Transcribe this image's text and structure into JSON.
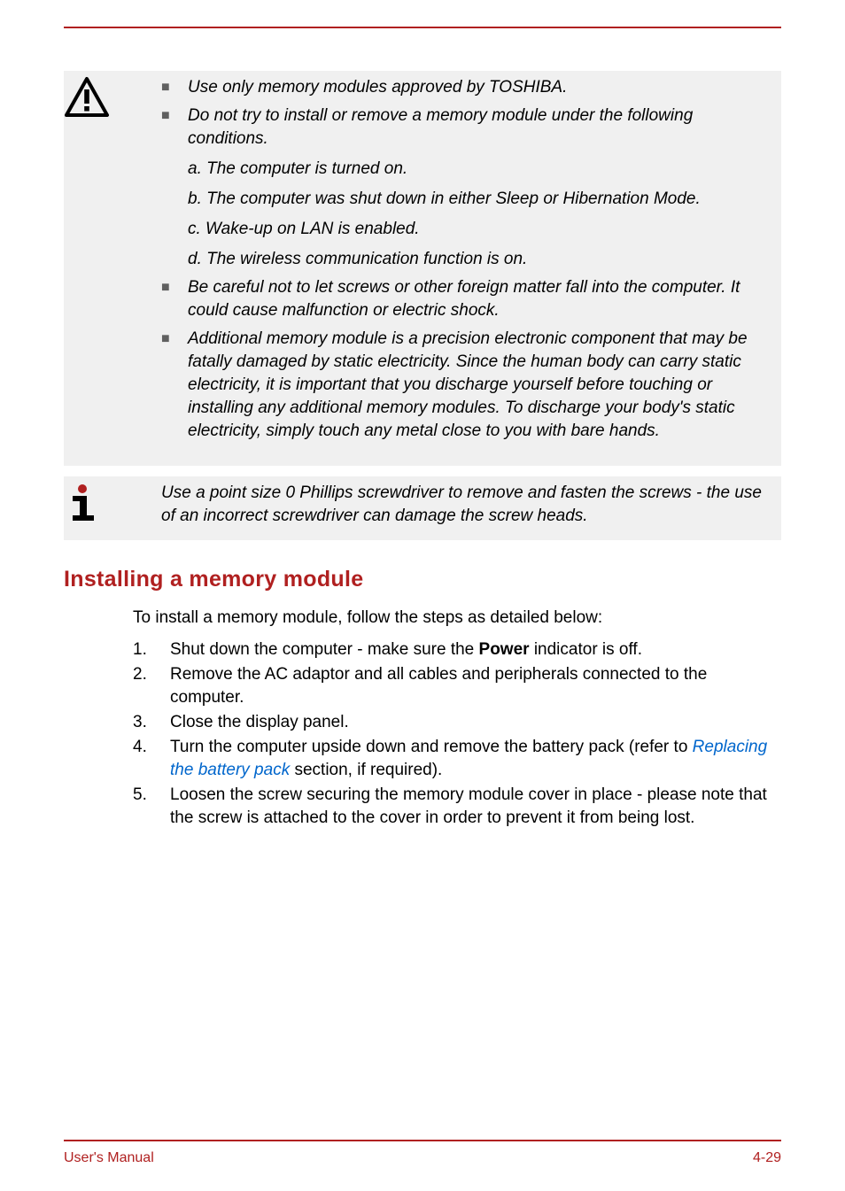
{
  "warning": {
    "bullets": [
      {
        "text": "Use only memory modules approved by TOSHIBA.",
        "subs": []
      },
      {
        "text": "Do not try to install or remove a memory module under the following conditions.",
        "subs": [
          "a. The computer is turned on.",
          "b. The computer was shut down in either Sleep or Hibernation Mode.",
          "c. Wake-up on LAN is enabled.",
          "d. The wireless communication function is on."
        ]
      },
      {
        "text": "Be careful not to let screws or other foreign matter fall into the computer. It could cause malfunction or electric shock.",
        "subs": []
      },
      {
        "text": "Additional memory module is a precision electronic component that may be fatally damaged by static electricity. Since the human body can carry static electricity, it is important that you discharge yourself before touching or installing any additional memory modules. To discharge your body's static electricity, simply touch any metal close to you with bare hands.",
        "subs": []
      }
    ]
  },
  "info": {
    "text": "Use a point size 0 Phillips screwdriver to remove and fasten the screws - the use of an incorrect screwdriver can damage the screw heads."
  },
  "section": {
    "heading": "Installing a memory module",
    "intro": "To install a memory module, follow the steps as detailed below:",
    "steps": [
      {
        "num": "1.",
        "pre": "Shut down the computer - make sure the ",
        "bold": "Power",
        "post": " indicator is off."
      },
      {
        "num": "2.",
        "text": "Remove the AC adaptor and all cables and peripherals connected to the computer."
      },
      {
        "num": "3.",
        "text": "Close the display panel."
      },
      {
        "num": "4.",
        "pre": "Turn the computer upside down and remove the battery pack (refer to ",
        "link": "Replacing the battery pack",
        "post": " section, if required)."
      },
      {
        "num": "5.",
        "text": "Loosen the screw securing the memory module cover in place - please note that the screw is attached to the cover in order to prevent it from being lost."
      }
    ]
  },
  "footer": {
    "left": "User's Manual",
    "right": "4-29"
  }
}
